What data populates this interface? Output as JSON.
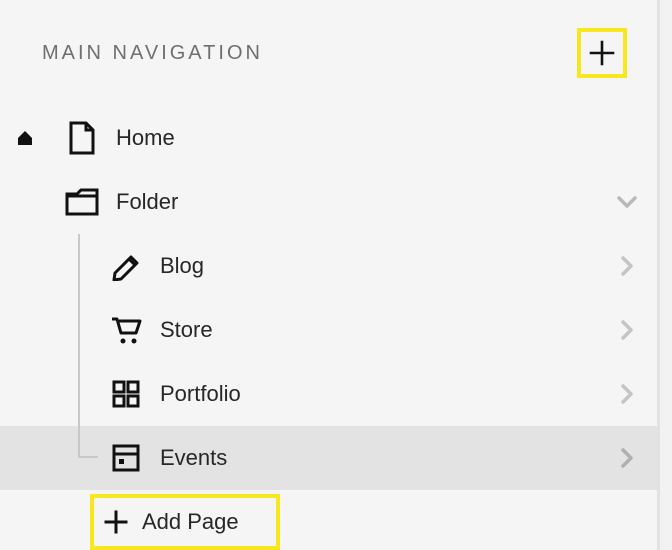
{
  "header": {
    "title": "MAIN NAVIGATION"
  },
  "nav": {
    "home": {
      "label": "Home"
    },
    "folder": {
      "label": "Folder"
    },
    "children": [
      {
        "key": "blog",
        "label": "Blog"
      },
      {
        "key": "store",
        "label": "Store"
      },
      {
        "key": "portfolio",
        "label": "Portfolio"
      },
      {
        "key": "events",
        "label": "Events"
      }
    ],
    "add_page": {
      "label": "Add Page"
    }
  },
  "colors": {
    "highlight": "#f8e71c",
    "selected_bg": "#e3e3e3"
  }
}
